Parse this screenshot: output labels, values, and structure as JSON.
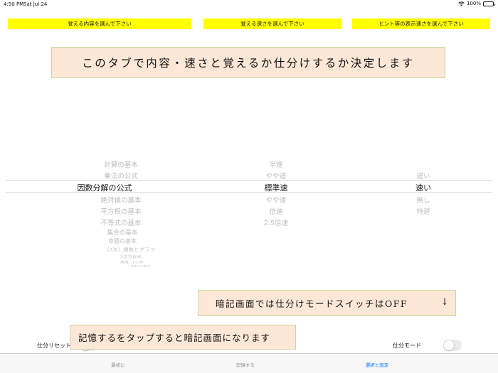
{
  "status_bar": {
    "time": "4:50 PM",
    "date": "Sat Jul 24",
    "battery": "100%"
  },
  "buttons": {
    "content": "覚える内容を選んで下さい",
    "speed": "覚える速さを選んで下さい",
    "hint_speed": "ヒント等の表示速さを選んで下さい"
  },
  "notes": {
    "top": "このタブで内容・速さと覚えるか仕分けするか決定します",
    "middle": "暗記画面では仕分けモードスイッチはOFF",
    "middle_arrow": "↓",
    "bottom": "記憶するをタップすると暗記画面になります"
  },
  "picker_content": {
    "items": [
      "計算の基本",
      "乗法の公式",
      "因数分解の公式",
      "絶対値の基本",
      "平方根の基本",
      "不等式の基本",
      "集合の基本",
      "命題の基本",
      "（2次）関数とグラフ",
      "2次方程式",
      "角度、rと座",
      "三角比の基本"
    ],
    "selected": "因数分解の公式"
  },
  "picker_speed": {
    "items": [
      "半速",
      "やや遅",
      "標準速",
      "やや速",
      "倍速",
      "2.5倍速"
    ],
    "selected": "標準速"
  },
  "picker_hint": {
    "items": [
      "遅い",
      "速い",
      "無し",
      "特遅"
    ],
    "selected": "速い"
  },
  "toggles": {
    "reset_label": "仕分リセット",
    "mode_label": "仕分モード",
    "reset_on": false,
    "mode_on": false
  },
  "tabs": [
    {
      "label": "最初に",
      "active": false
    },
    {
      "label": "記憶する",
      "active": false
    },
    {
      "label": "選択と設定",
      "active": true
    }
  ],
  "colors": {
    "button_bg": "#ffff00",
    "note_bg": "#fde7d7",
    "note_border": "#c8d6a0",
    "active_tab": "#007aff"
  }
}
